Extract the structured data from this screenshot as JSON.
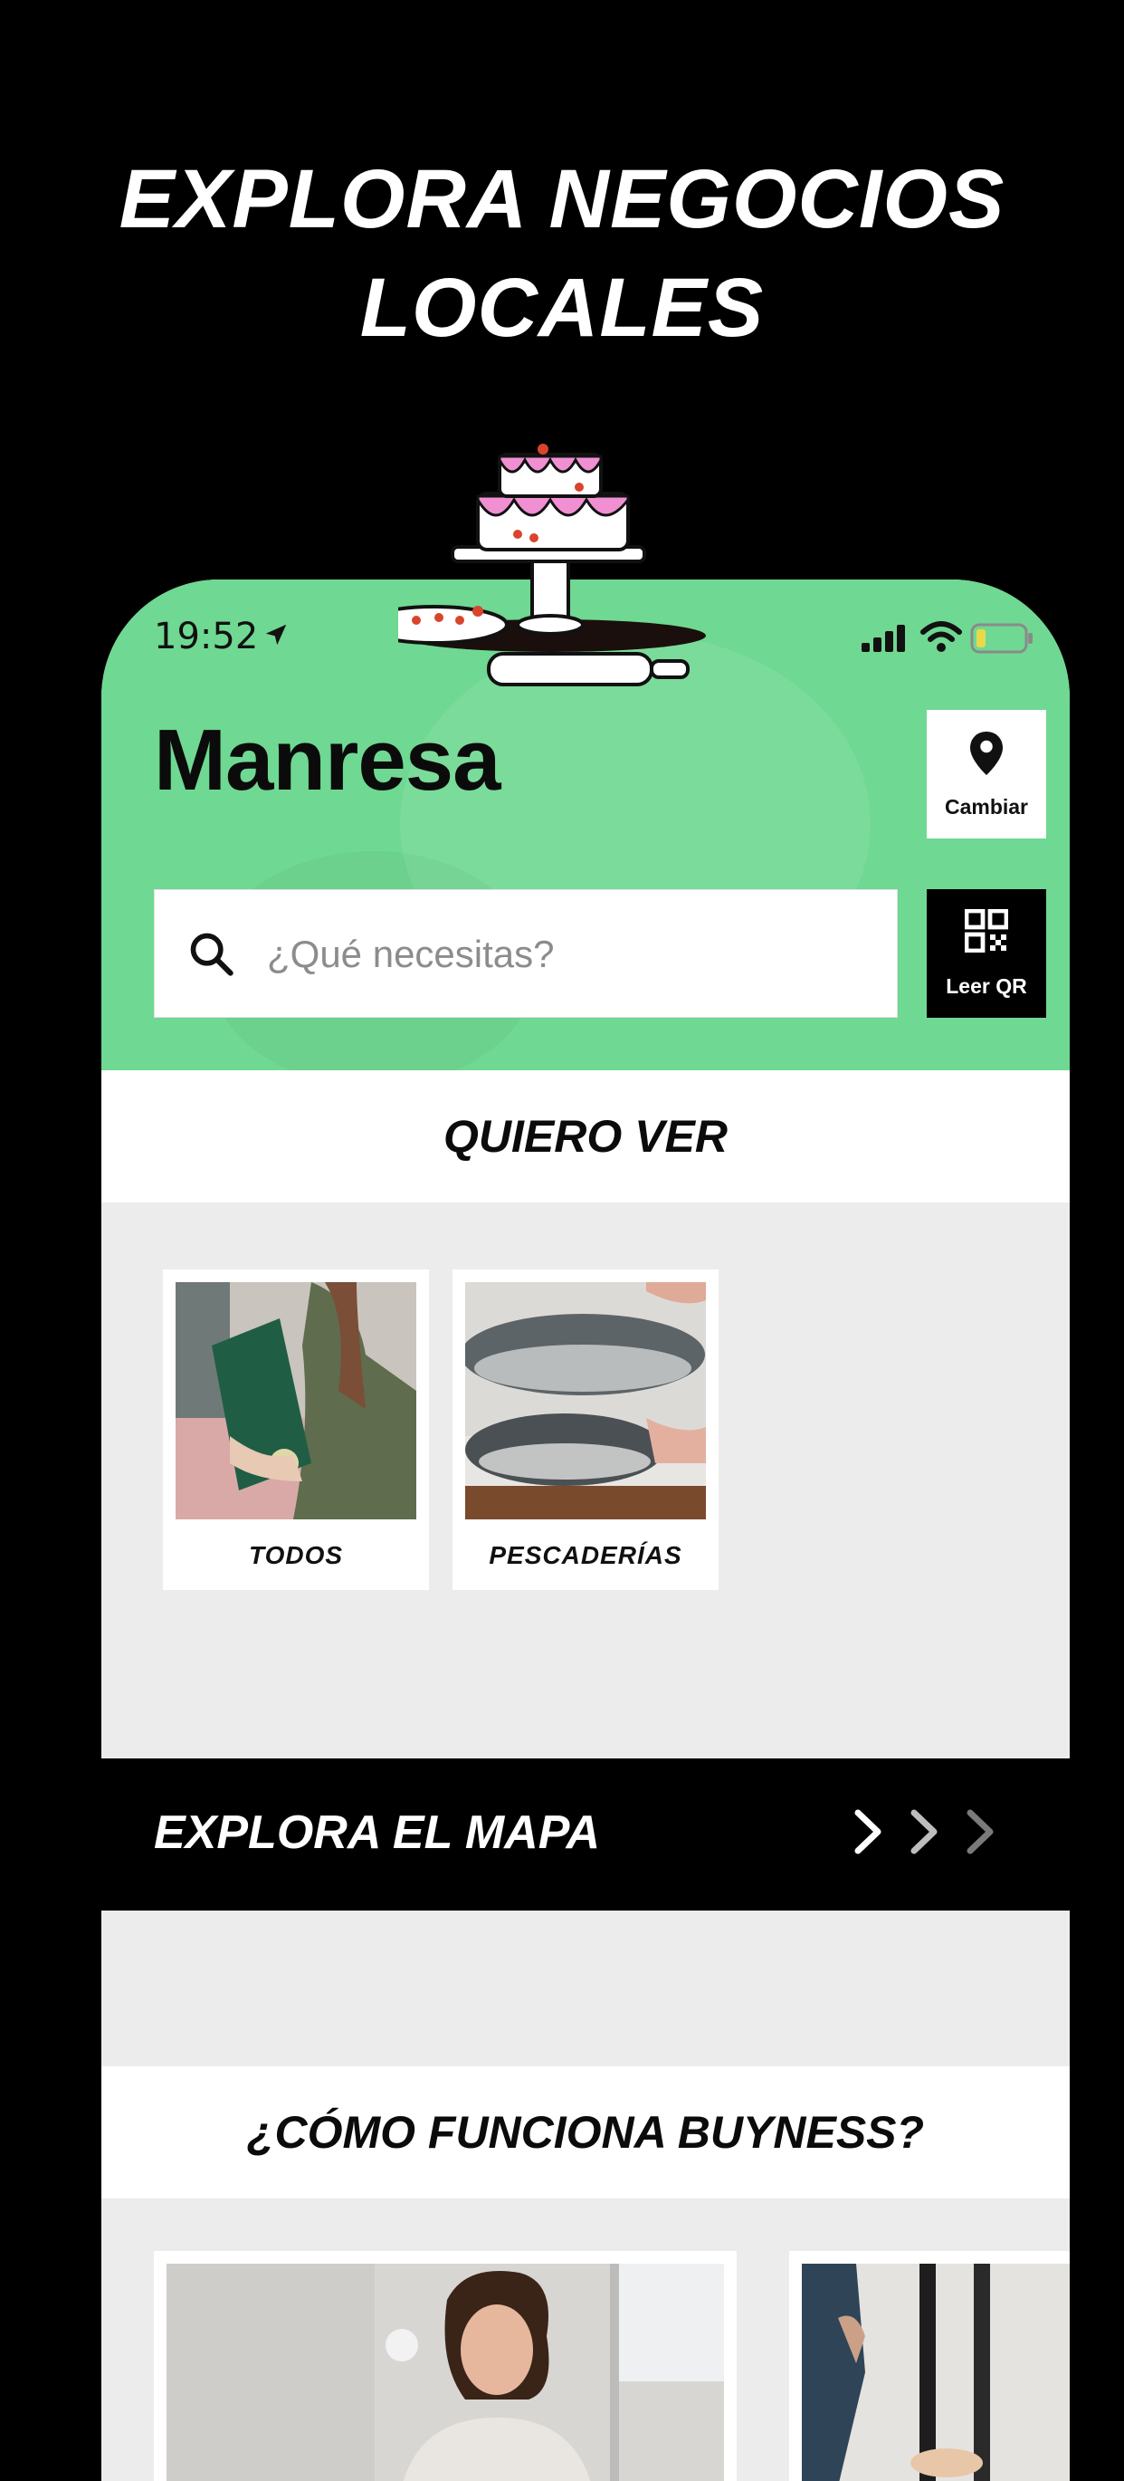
{
  "headline": {
    "line1": "EXPLORA NEGOCIOS",
    "line2": "LOCALES"
  },
  "status_bar": {
    "time": "19:52"
  },
  "header": {
    "city": "Manresa",
    "change_label": "Cambiar"
  },
  "search": {
    "placeholder": "¿Qué necesitas?",
    "qr_label": "Leer QR"
  },
  "sections": {
    "quiero_ver": "QUIERO VER",
    "categories": [
      {
        "label": "TODOS"
      },
      {
        "label": "PESCADERÍAS"
      }
    ],
    "map_label": "EXPLORA EL MAPA",
    "how_it_works": "¿CÓMO FUNCIONA BUYNESS?"
  },
  "colors": {
    "accent_green": "#6fd892",
    "background": "#000000",
    "panel": "#ececec"
  },
  "icons": [
    "location-arrow-icon",
    "signal-icon",
    "wifi-icon",
    "battery-icon",
    "map-pin-icon",
    "search-icon",
    "qr-code-icon",
    "chevron-right-icon"
  ]
}
